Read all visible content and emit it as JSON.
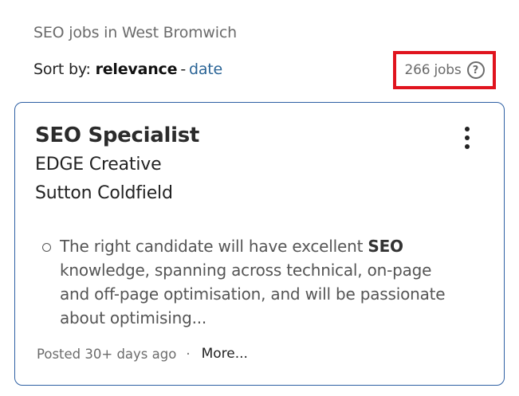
{
  "header": {
    "search_heading": "SEO jobs in West Bromwich",
    "sort_label": "Sort by: ",
    "sort_active": "relevance",
    "sort_separator": "-",
    "sort_option_date": "date",
    "job_count": "266 jobs",
    "help_symbol": "?"
  },
  "job": {
    "title": "SEO Specialist",
    "company": "EDGE Creative",
    "location": "Sutton Coldfield",
    "snippet_before": "The right candidate will have excellent ",
    "snippet_highlight": "SEO",
    "snippet_after": " knowledge, spanning across technical, on-page and off-page optimisation, and will be passionate about optimising...",
    "posted": "Posted 30+ days ago",
    "separator": "·",
    "more_label": "More..."
  },
  "colors": {
    "card_border": "#2d5fa3",
    "link": "#2a6496",
    "highlight_box": "#e0141e"
  }
}
